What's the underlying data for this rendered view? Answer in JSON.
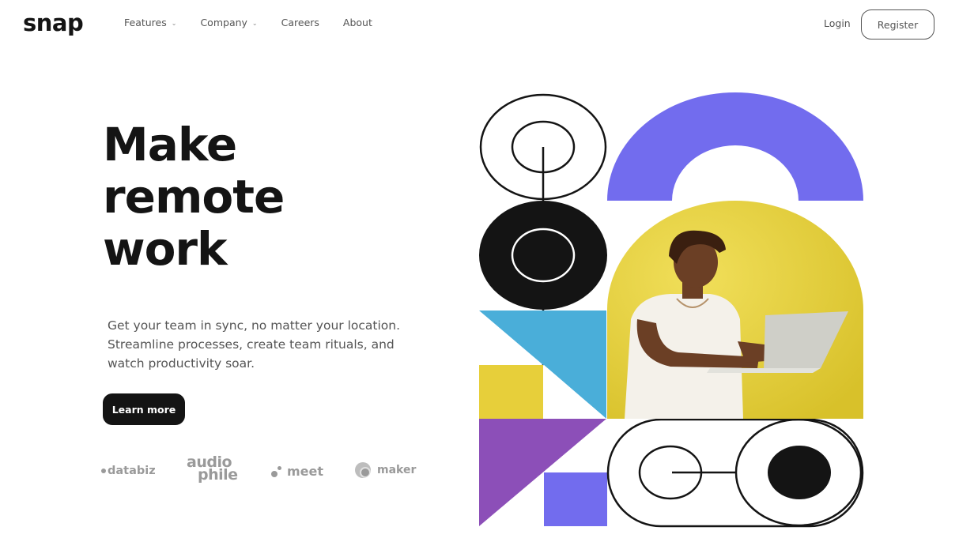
{
  "brand": {
    "logo_text": "snap"
  },
  "nav": {
    "items": [
      {
        "label": "Features",
        "has_dropdown": true
      },
      {
        "label": "Company",
        "has_dropdown": true
      },
      {
        "label": "Careers",
        "has_dropdown": false
      },
      {
        "label": "About",
        "has_dropdown": false
      }
    ],
    "chevron_glyph": "⌄"
  },
  "auth": {
    "login_label": "Login",
    "register_label": "Register"
  },
  "hero": {
    "headline_lines": [
      "Make",
      "remote",
      "work"
    ],
    "description_lines": [
      "Get your team in sync, no matter your location.",
      "Streamline processes, create team rituals, and",
      "watch productivity soar."
    ],
    "cta_label": "Learn more"
  },
  "clients": {
    "databiz": "databiz",
    "audiophile_lines": [
      "audio",
      "phile"
    ],
    "meet": "meet",
    "maker": "maker"
  },
  "colors": {
    "ink": "#141414",
    "muted_text": "#555555",
    "logo_gray": "#9a9a9a",
    "purple_arch": "#726cee",
    "yellow": "#e7cf3a",
    "sky_blue": "#4aaed9",
    "violet": "#8c4fb8",
    "square_purple": "#726cee"
  },
  "icons": {
    "feature_chevron": "chevron-down-icon",
    "art": [
      "circles-pendulum-icon",
      "arch-icon",
      "triangles-icon",
      "toggle-knob-icon"
    ]
  }
}
